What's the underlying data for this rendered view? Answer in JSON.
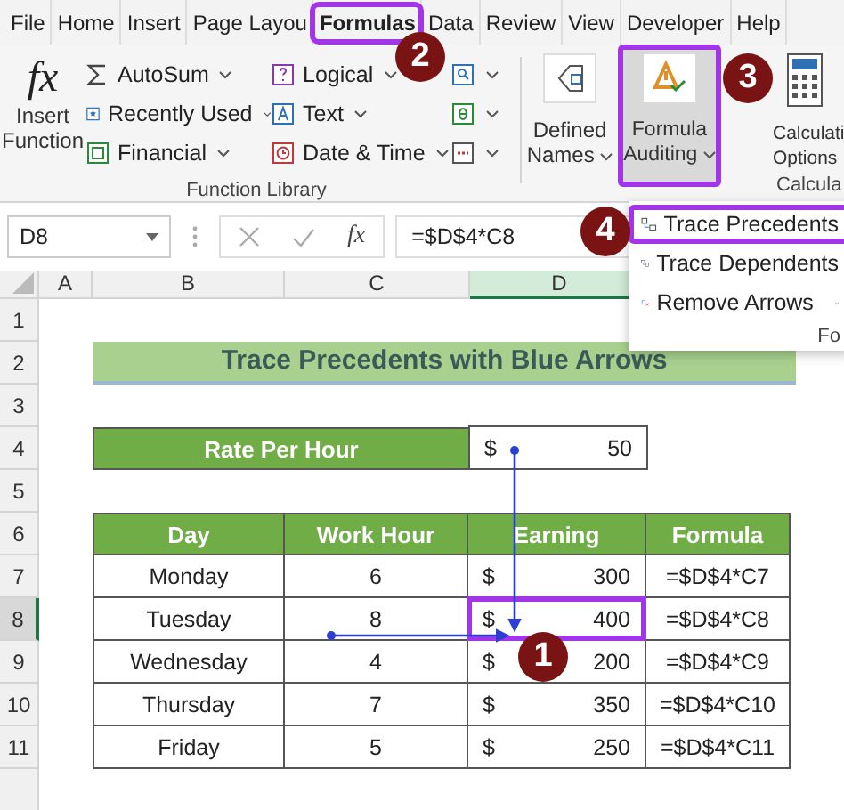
{
  "tabs": [
    {
      "label": "File",
      "selected": false
    },
    {
      "label": "Home",
      "selected": false
    },
    {
      "label": "Insert",
      "selected": false
    },
    {
      "label": "Page Layou",
      "selected": false
    },
    {
      "label": "Formulas",
      "selected": true
    },
    {
      "label": "Data",
      "selected": false
    },
    {
      "label": "Review",
      "selected": false
    },
    {
      "label": "View",
      "selected": false
    },
    {
      "label": "Developer",
      "selected": false
    },
    {
      "label": "Help",
      "selected": false
    }
  ],
  "ribbon": {
    "insert_function": {
      "icon_text": "fx",
      "label": "Insert Function"
    },
    "function_items": [
      {
        "label": "AutoSum",
        "dropdown": true
      },
      {
        "label": "Recently Used",
        "dropdown": true
      },
      {
        "label": "Financial",
        "dropdown": true
      },
      {
        "label": "Logical",
        "dropdown": true
      },
      {
        "label": "Text",
        "dropdown": true
      },
      {
        "label": "Date & Time",
        "dropdown": true
      }
    ],
    "function_group_label": "Function Library",
    "defined_names": {
      "lines": [
        "Defined",
        "Names"
      ]
    },
    "formula_auditing": {
      "lines": [
        "Formula",
        "Auditing"
      ],
      "highlighted": true
    },
    "calculation": {
      "lines": [
        "Calculati",
        "Options"
      ]
    },
    "calculation_group_label": "Calcula"
  },
  "formula_bar": {
    "name_box": "D8",
    "fx": "fx",
    "formula": "=$D$4*C8"
  },
  "auditing_menu": {
    "items": [
      {
        "label": "Trace Precedents",
        "highlighted": true,
        "dropdown": false
      },
      {
        "label": "Trace Dependents",
        "highlighted": false,
        "dropdown": false
      },
      {
        "label": "Remove Arrows",
        "highlighted": false,
        "dropdown": true
      }
    ],
    "group_label": "Fo"
  },
  "sheet": {
    "columns": [
      {
        "label": "A",
        "selected": false
      },
      {
        "label": "B",
        "selected": false
      },
      {
        "label": "C",
        "selected": false
      },
      {
        "label": "D",
        "selected": true
      }
    ],
    "row_headers": [
      {
        "label": "1",
        "selected": false
      },
      {
        "label": "2",
        "selected": false
      },
      {
        "label": "3",
        "selected": false
      },
      {
        "label": "4",
        "selected": false
      },
      {
        "label": "5",
        "selected": false
      },
      {
        "label": "6",
        "selected": false
      },
      {
        "label": "7",
        "selected": false
      },
      {
        "label": "8",
        "selected": true
      },
      {
        "label": "9",
        "selected": false
      },
      {
        "label": "10",
        "selected": false
      },
      {
        "label": "11",
        "selected": false
      }
    ],
    "title": "Trace Precedents with Blue Arrows",
    "rate": {
      "label": "Rate Per Hour",
      "currency": "$",
      "value": "50"
    },
    "table": {
      "columns": [
        "Day",
        "Work Hour",
        "Earning",
        "Formula"
      ],
      "rows": [
        {
          "day": "Monday",
          "hours": "6",
          "currency": "$",
          "earning": "300",
          "formula": "=$D$4*C7",
          "highlighted": false
        },
        {
          "day": "Tuesday",
          "hours": "8",
          "currency": "$",
          "earning": "400",
          "formula": "=$D$4*C8",
          "highlighted": true
        },
        {
          "day": "Wednesday",
          "hours": "4",
          "currency": "$",
          "earning": "200",
          "formula": "=$D$4*C9",
          "highlighted": false
        },
        {
          "day": "Thursday",
          "hours": "7",
          "currency": "$",
          "earning": "350",
          "formula": "=$D$4*C10",
          "highlighted": false
        },
        {
          "day": "Friday",
          "hours": "5",
          "currency": "$",
          "earning": "250",
          "formula": "=$D$4*C11",
          "highlighted": false
        }
      ]
    }
  },
  "callouts": [
    "1",
    "2",
    "3",
    "4"
  ]
}
